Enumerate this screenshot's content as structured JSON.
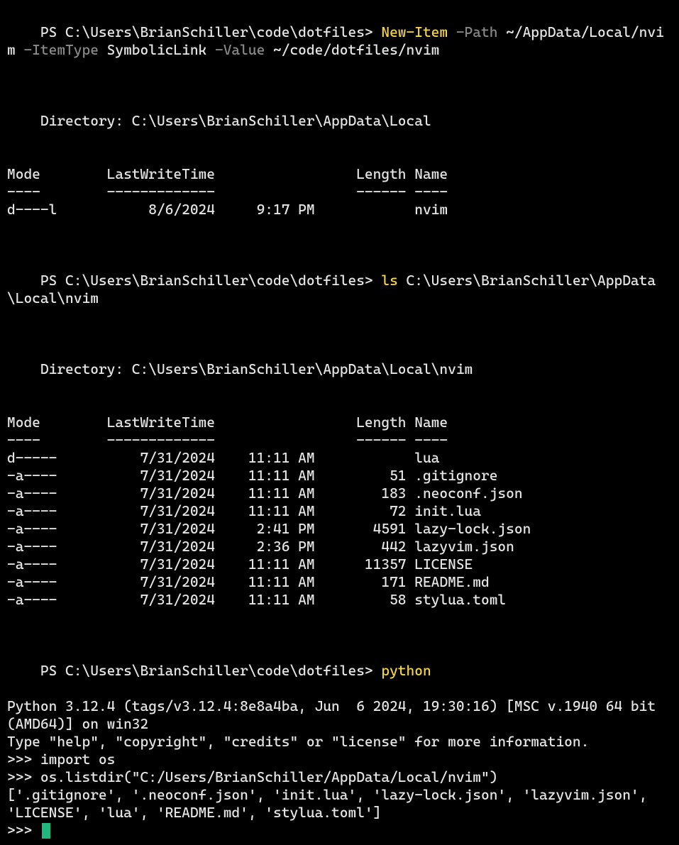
{
  "cmd1": {
    "prompt": "PS C:\\Users\\BrianSchiller\\code\\dotfiles> ",
    "cmdlet": "New-Item",
    "p_path": " -Path ",
    "path": "~/AppData/Local/nvim ",
    "p_itemtype": "-ItemType ",
    "itemtype": "SymbolicLink",
    "p_value": " -Value ",
    "value": "~/code/dotfiles/nvim"
  },
  "dir1": {
    "label": "Directory: C:\\Users\\BrianSchiller\\AppData\\Local",
    "headers": {
      "mode": "Mode",
      "lwt": "LastWriteTime",
      "len": "Length",
      "name": "Name"
    },
    "seps": {
      "mode": "----",
      "lwt": "-------------",
      "len": "------",
      "name": "----"
    },
    "rows": [
      {
        "mode": "d----l",
        "date": "8/6/2024",
        "time": "9:17 PM",
        "len": "",
        "name": "nvim"
      }
    ]
  },
  "cmd2": {
    "prompt": "PS C:\\Users\\BrianSchiller\\code\\dotfiles> ",
    "cmd": "ls",
    "args": " C:\\Users\\BrianSchiller\\AppData\\Local\\nvim"
  },
  "dir2": {
    "label": "Directory: C:\\Users\\BrianSchiller\\AppData\\Local\\nvim",
    "headers": {
      "mode": "Mode",
      "lwt": "LastWriteTime",
      "len": "Length",
      "name": "Name"
    },
    "seps": {
      "mode": "----",
      "lwt": "-------------",
      "len": "------",
      "name": "----"
    },
    "rows": [
      {
        "mode": "d-----",
        "date": "7/31/2024",
        "time": "11:11 AM",
        "len": "",
        "name": "lua"
      },
      {
        "mode": "-a----",
        "date": "7/31/2024",
        "time": "11:11 AM",
        "len": "51",
        "name": ".gitignore"
      },
      {
        "mode": "-a----",
        "date": "7/31/2024",
        "time": "11:11 AM",
        "len": "183",
        "name": ".neoconf.json"
      },
      {
        "mode": "-a----",
        "date": "7/31/2024",
        "time": "11:11 AM",
        "len": "72",
        "name": "init.lua"
      },
      {
        "mode": "-a----",
        "date": "7/31/2024",
        "time": "2:41 PM",
        "len": "4591",
        "name": "lazy-lock.json"
      },
      {
        "mode": "-a----",
        "date": "7/31/2024",
        "time": "2:36 PM",
        "len": "442",
        "name": "lazyvim.json"
      },
      {
        "mode": "-a----",
        "date": "7/31/2024",
        "time": "11:11 AM",
        "len": "11357",
        "name": "LICENSE"
      },
      {
        "mode": "-a----",
        "date": "7/31/2024",
        "time": "11:11 AM",
        "len": "171",
        "name": "README.md"
      },
      {
        "mode": "-a----",
        "date": "7/31/2024",
        "time": "11:11 AM",
        "len": "58",
        "name": "stylua.toml"
      }
    ]
  },
  "cmd3": {
    "prompt": "PS C:\\Users\\BrianSchiller\\code\\dotfiles> ",
    "cmd": "python"
  },
  "python": {
    "banner": "Python 3.12.4 (tags/v3.12.4:8e8a4ba, Jun  6 2024, 19:30:16) [MSC v.1940 64 bit (AMD64)] on win32",
    "help": "Type \"help\", \"copyright\", \"credits\" or \"license\" for more information.",
    "p1": ">>> import os",
    "p2": ">>> os.listdir(\"C:/Users/BrianSchiller/AppData/Local/nvim\")",
    "out": "['.gitignore', '.neoconf.json', 'init.lua', 'lazy-lock.json', 'lazyvim.json', 'LICENSE', 'lua', 'README.md', 'stylua.toml']",
    "p3": ">>> "
  }
}
